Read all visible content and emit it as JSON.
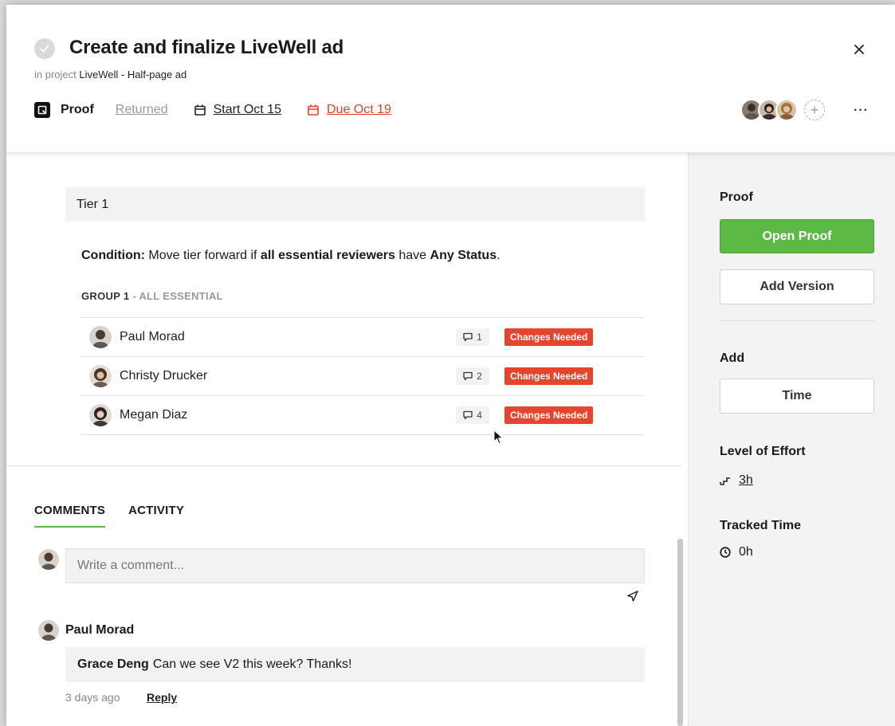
{
  "task": {
    "title": "Create and finalize LiveWell ad",
    "project_prefix": "in project",
    "project_name": "LiveWell - Half-page ad"
  },
  "meta": {
    "type_label": "Proof",
    "status": "Returned",
    "start": "Start Oct 15",
    "due": "Due Oct 19"
  },
  "header_actions": {
    "add_member": "+",
    "more": "···"
  },
  "tier": {
    "label": "Tier 1",
    "condition_prefix": "Condition:",
    "condition_text_1": "Move tier forward if",
    "condition_bold_1": "all essential reviewers",
    "condition_text_2": "have",
    "condition_bold_2": "Any Status",
    "condition_end": "."
  },
  "group": {
    "name": "GROUP 1",
    "suffix": "- ALL ESSENTIAL"
  },
  "reviewers": [
    {
      "name": "Paul Morad",
      "comments": "1",
      "status": "Changes Needed"
    },
    {
      "name": "Christy Drucker",
      "comments": "2",
      "status": "Changes Needed"
    },
    {
      "name": "Megan Diaz",
      "comments": "4",
      "status": "Changes Needed"
    }
  ],
  "tabs": [
    {
      "label": "COMMENTS",
      "active": true
    },
    {
      "label": "ACTIVITY",
      "active": false
    }
  ],
  "comment_input": {
    "placeholder": "Write a comment..."
  },
  "comments": [
    {
      "author": "Paul Morad",
      "mention": "Grace Deng",
      "text": "Can we see V2 this week? Thanks!",
      "time": "3 days ago",
      "reply_label": "Reply"
    }
  ],
  "sidebar": {
    "proof_title": "Proof",
    "open_proof": "Open Proof",
    "add_version": "Add Version",
    "add_title": "Add",
    "time_button": "Time",
    "effort_title": "Level of Effort",
    "effort_value": "3h",
    "tracked_title": "Tracked Time",
    "tracked_value": "0h"
  },
  "colors": {
    "accent_green": "#5cb946",
    "danger_red": "#e5452f",
    "due_red": "#e0432b"
  }
}
